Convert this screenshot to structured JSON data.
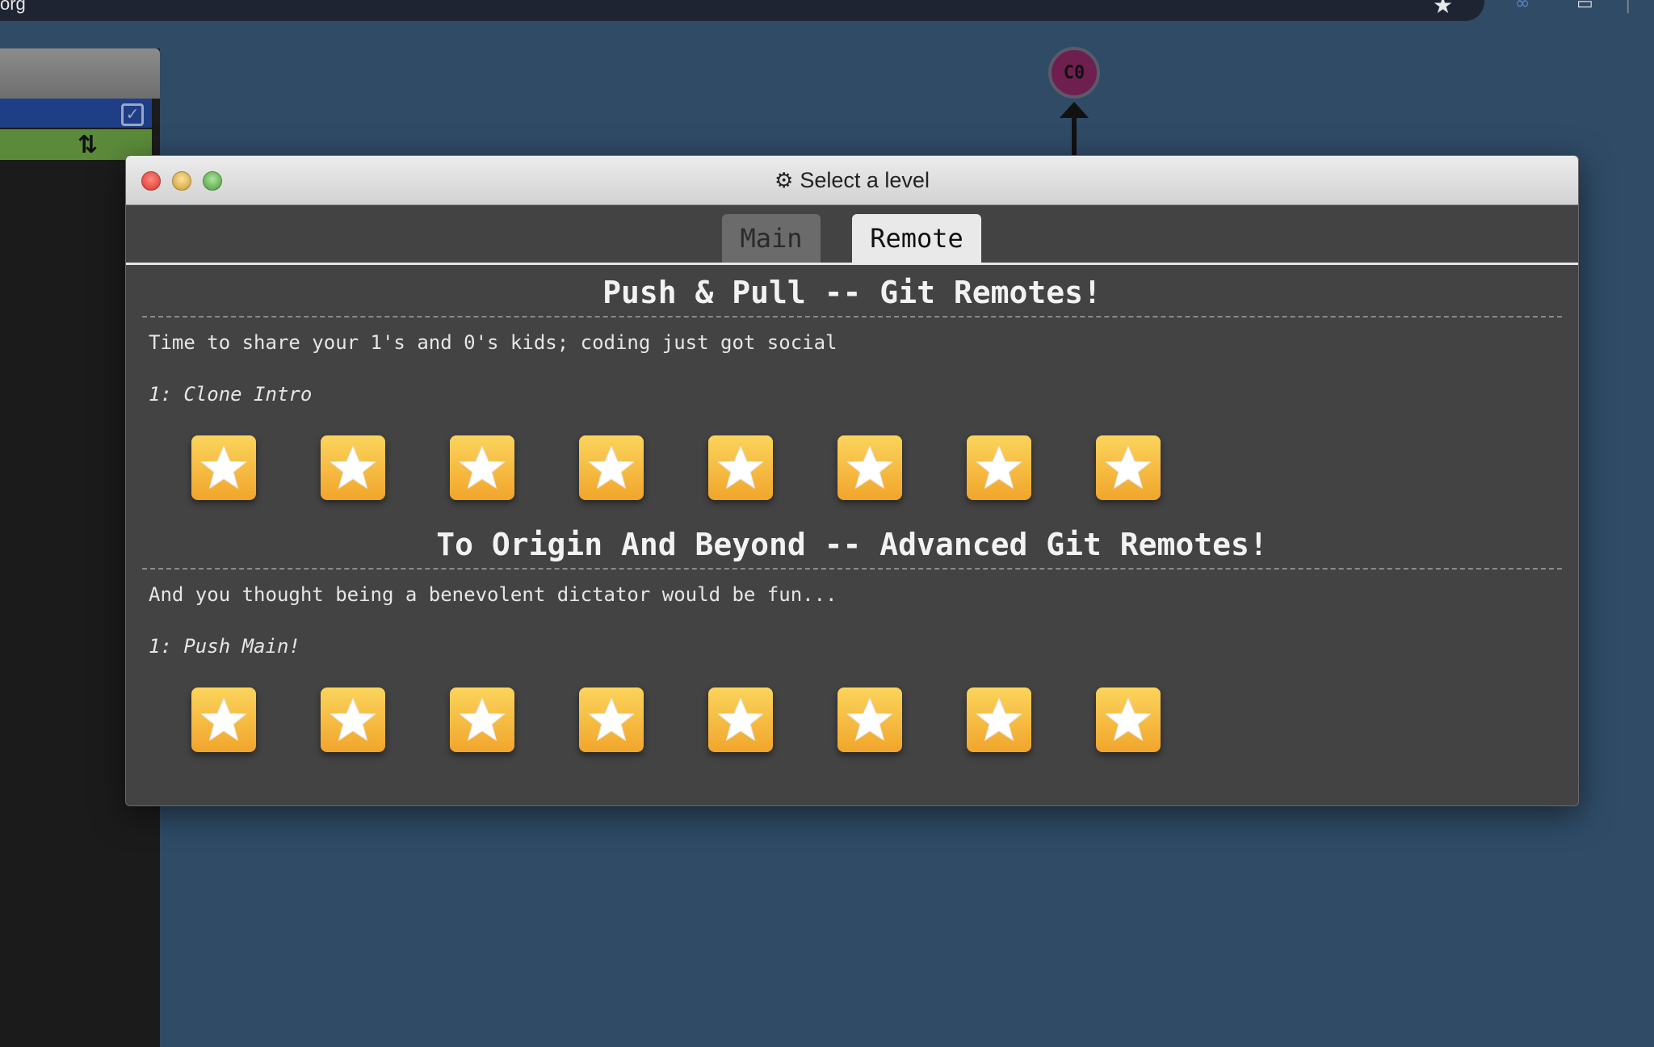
{
  "browser": {
    "url_fragment": "org"
  },
  "graph": {
    "commit_label": "C0"
  },
  "dialog": {
    "title": "Select a level",
    "tabs": [
      {
        "label": "Main",
        "active": false
      },
      {
        "label": "Remote",
        "active": true
      }
    ],
    "sections": [
      {
        "title": "Push & Pull -- Git Remotes!",
        "description": "Time to share your 1's and 0's kids; coding just got social",
        "current_level": "1: Clone Intro",
        "level_count": 8
      },
      {
        "title": "To Origin And Beyond -- Advanced Git Remotes!",
        "description": "And you thought being a benevolent dictator would be fun...",
        "current_level": "1: Push Main!",
        "level_count": 8
      }
    ]
  },
  "colors": {
    "background": "#2f4b66",
    "dialog_bg": "#434343",
    "star_tile": "#f6bc3e",
    "commit_node": "#6e1f4f"
  }
}
